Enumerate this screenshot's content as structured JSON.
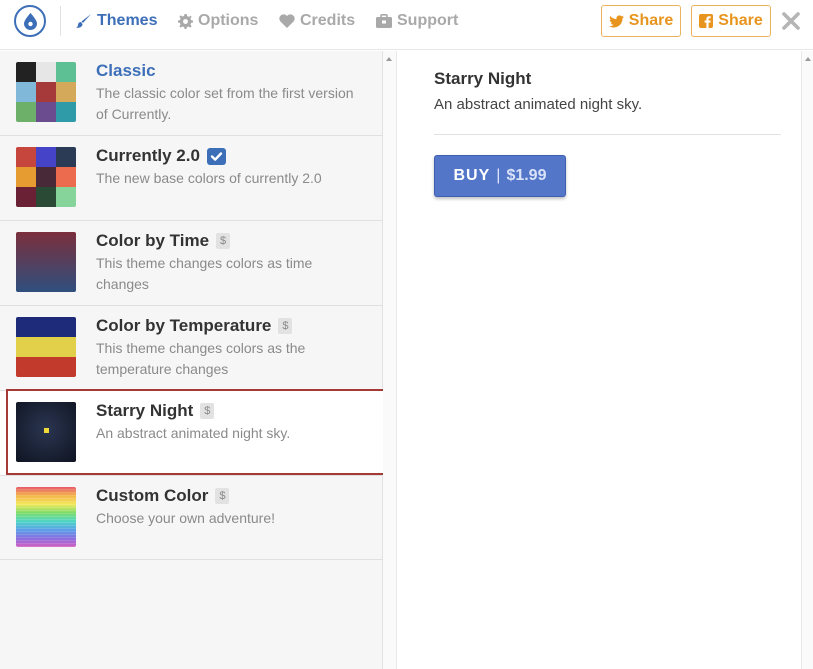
{
  "header": {
    "logo_icon": "drop-icon",
    "tabs": [
      {
        "label": "Themes",
        "icon": "brush-icon",
        "active": true
      },
      {
        "label": "Options",
        "icon": "gear-icon",
        "active": false
      },
      {
        "label": "Credits",
        "icon": "heart-icon",
        "active": false
      },
      {
        "label": "Support",
        "icon": "briefcase-icon",
        "active": false
      }
    ],
    "share_buttons": [
      {
        "label": "Share",
        "icon": "twitter-icon"
      },
      {
        "label": "Share",
        "icon": "facebook-icon"
      }
    ],
    "close_icon": "close-icon"
  },
  "themes": [
    {
      "title": "Classic",
      "description": "The classic color set from the first version of Currently.",
      "paid": false,
      "checked": false,
      "colors": [
        "#222222",
        "#e6e6e6",
        "#5dbf94",
        "#80b8d9",
        "#a6393a",
        "#d4aa5a",
        "#6db06a",
        "#6b4c8f",
        "#2f9aa8"
      ]
    },
    {
      "title": "Currently 2.0",
      "description": "The new base colors of currently 2.0",
      "paid": false,
      "checked": true,
      "colors": [
        "#c6463d",
        "#4544c8",
        "#2c3b55",
        "#e79c31",
        "#472938",
        "#ec6b4e",
        "#6a2035",
        "#2a4a35",
        "#86d49a"
      ]
    },
    {
      "title": "Color by Time",
      "description": "This theme changes colors as time changes",
      "paid": true,
      "checked": false,
      "colors": [
        "#7b2f3c",
        "#2f4f7e"
      ]
    },
    {
      "title": "Color by Temperature",
      "description": "This theme changes colors as the temperature changes",
      "paid": true,
      "checked": false,
      "colors": [
        "#1e2a7a",
        "#e3d04a",
        "#c23a2c"
      ]
    },
    {
      "title": "Starry Night",
      "description": "An abstract animated night sky.",
      "paid": true,
      "checked": false,
      "colors": [
        "#2a3550",
        "#0f1422",
        "#f2d93a"
      ]
    },
    {
      "title": "Custom Color",
      "description": "Choose your own adventure!",
      "paid": true,
      "checked": false,
      "colors": [
        "#e85a6b",
        "#f4b54a",
        "#f3e85a",
        "#7fdc6a",
        "#4fd6c4",
        "#5aa0e8",
        "#8a6ee0",
        "#d25fc0"
      ]
    }
  ],
  "paid_badge": "$",
  "selected_index": 4,
  "detail": {
    "title": "Starry Night",
    "description": "An abstract animated night sky.",
    "buy_label": "BUY",
    "buy_separator": "|",
    "price": "$1.99"
  },
  "colors": {
    "accent": "#3d6fb8",
    "share": "#e8951f",
    "selection_border": "#a43a33",
    "buy_button": "#5376c9"
  }
}
